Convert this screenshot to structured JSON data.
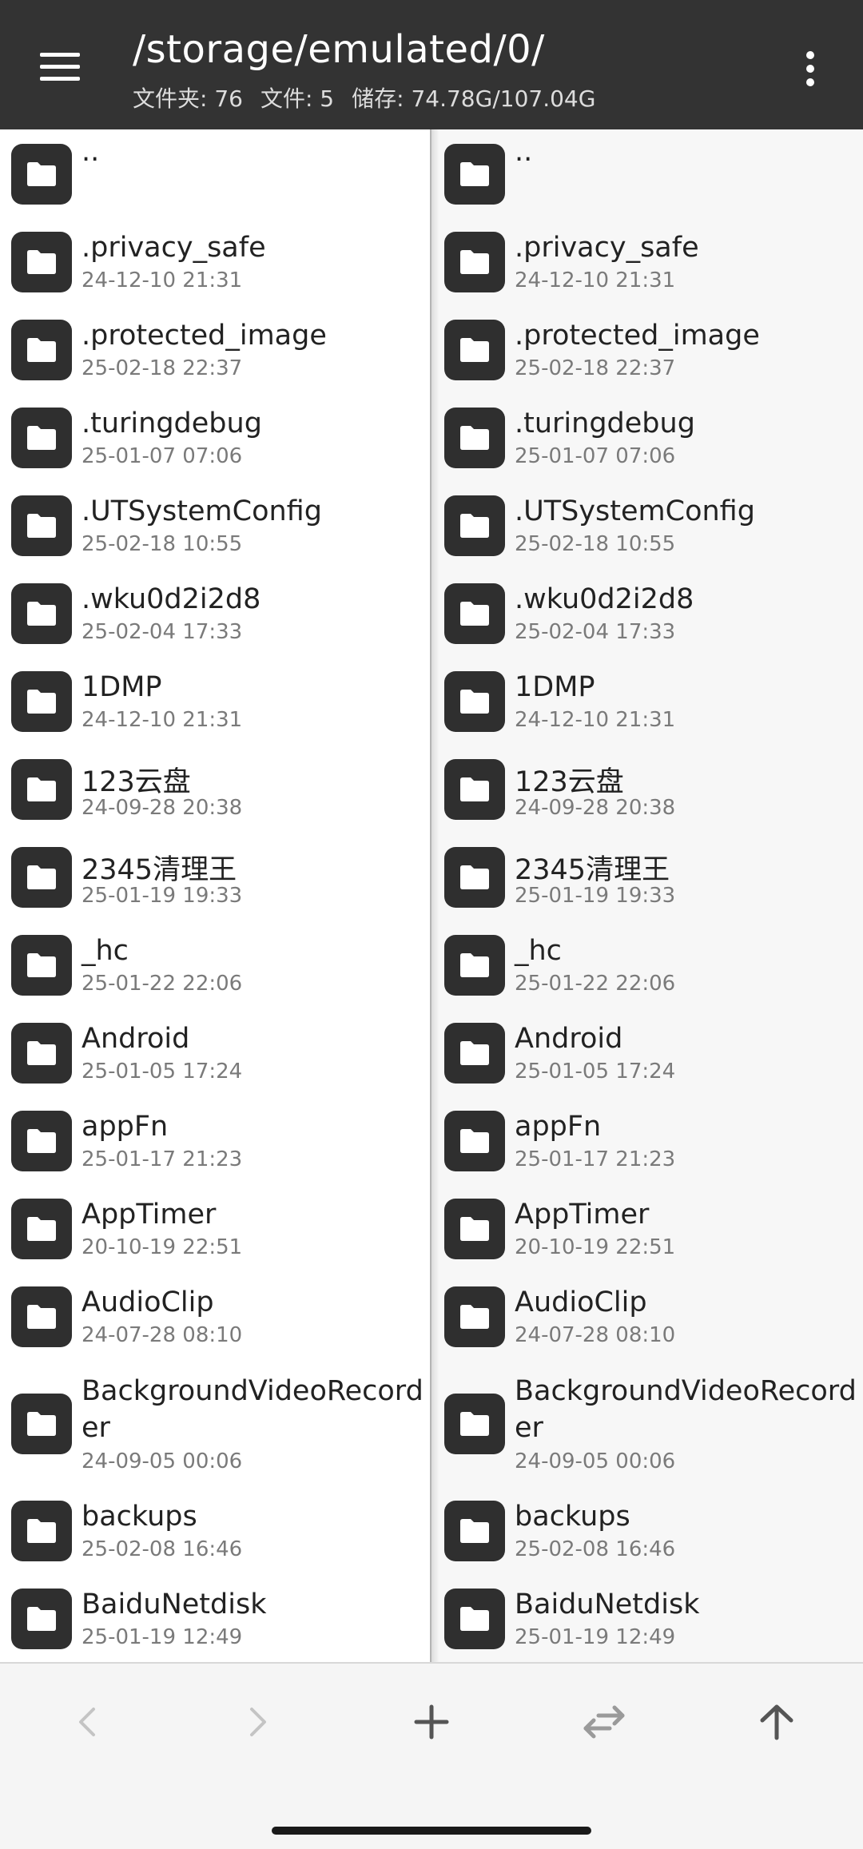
{
  "header": {
    "path": "/storage/emulated/0/",
    "stats": {
      "folders": "文件夹: 76",
      "files": "文件: 5",
      "storage": "储存: 74.78G/107.04G"
    }
  },
  "left_pane": {
    "items": [
      {
        "name": "..",
        "date": ""
      },
      {
        "name": ".privacy_safe",
        "date": "24-12-10 21:31"
      },
      {
        "name": ".protected_image",
        "date": "25-02-18 22:37"
      },
      {
        "name": ".turingdebug",
        "date": "25-01-07 07:06"
      },
      {
        "name": ".UTSystemConfig",
        "date": "25-02-18 10:55"
      },
      {
        "name": ".wku0d2i2d8",
        "date": "25-02-04 17:33"
      },
      {
        "name": "1DMP",
        "date": "24-12-10 21:31"
      },
      {
        "name": "123云盘",
        "date": "24-09-28 20:38"
      },
      {
        "name": "2345清理王",
        "date": "25-01-19 19:33"
      },
      {
        "name": "_hc",
        "date": "25-01-22 22:06"
      },
      {
        "name": "Android",
        "date": "25-01-05 17:24"
      },
      {
        "name": "appFn",
        "date": "25-01-17 21:23"
      },
      {
        "name": "AppTimer",
        "date": "20-10-19 22:51"
      },
      {
        "name": "AudioClip",
        "date": "24-07-28 08:10"
      },
      {
        "name": "BackgroundVideoRecorder",
        "date": "24-09-05 00:06"
      },
      {
        "name": "backups",
        "date": "25-02-08 16:46"
      },
      {
        "name": "BaiduNetdisk",
        "date": "25-01-19 12:49"
      }
    ]
  },
  "right_pane": {
    "items": [
      {
        "name": "..",
        "date": ""
      },
      {
        "name": ".privacy_safe",
        "date": "24-12-10 21:31"
      },
      {
        "name": ".protected_image",
        "date": "25-02-18 22:37"
      },
      {
        "name": ".turingdebug",
        "date": "25-01-07 07:06"
      },
      {
        "name": ".UTSystemConfig",
        "date": "25-02-18 10:55"
      },
      {
        "name": ".wku0d2i2d8",
        "date": "25-02-04 17:33"
      },
      {
        "name": "1DMP",
        "date": "24-12-10 21:31"
      },
      {
        "name": "123云盘",
        "date": "24-09-28 20:38"
      },
      {
        "name": "2345清理王",
        "date": "25-01-19 19:33"
      },
      {
        "name": "_hc",
        "date": "25-01-22 22:06"
      },
      {
        "name": "Android",
        "date": "25-01-05 17:24"
      },
      {
        "name": "appFn",
        "date": "25-01-17 21:23"
      },
      {
        "name": "AppTimer",
        "date": "20-10-19 22:51"
      },
      {
        "name": "AudioClip",
        "date": "24-07-28 08:10"
      },
      {
        "name": "BackgroundVideoRecorder",
        "date": "24-09-05 00:06"
      },
      {
        "name": "backups",
        "date": "25-02-08 16:46"
      },
      {
        "name": "BaiduNetdisk",
        "date": "25-01-19 12:49"
      }
    ]
  },
  "toolbar": {
    "icons": [
      "back-icon",
      "forward-icon",
      "add-icon",
      "swap-icon",
      "up-arrow-icon"
    ]
  },
  "colors": {
    "header_bg": "#333333",
    "folder_tile": "#2f2f2f",
    "date_text": "#7a7a7a"
  }
}
